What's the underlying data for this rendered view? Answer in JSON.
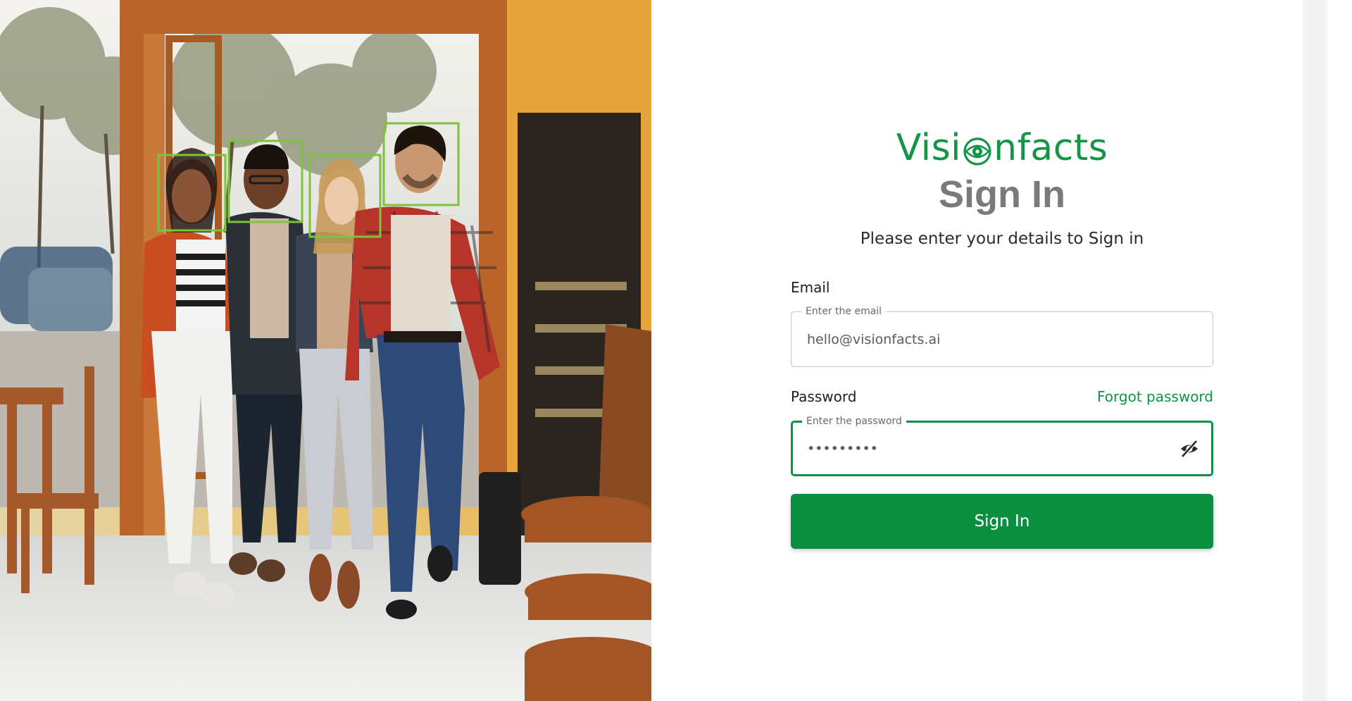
{
  "brand": {
    "logo_prefix": "Visi",
    "logo_suffix": "nfacts",
    "accent_color": "#149447",
    "primary_color": "#0a8f41"
  },
  "form": {
    "title": "Sign In",
    "subtitle": "Please enter your details to Sign in",
    "email": {
      "label": "Email",
      "legend": "Enter the email",
      "value": "hello@visionfacts.ai"
    },
    "password": {
      "label": "Password",
      "forgot_label": "Forgot password",
      "legend": "Enter the password",
      "value": "•••••••••",
      "toggle_icon": "eye-off-icon"
    },
    "submit_label": "Sign In"
  },
  "hero": {
    "face_box_color": "#7cc43a",
    "face_box_count": 4
  }
}
